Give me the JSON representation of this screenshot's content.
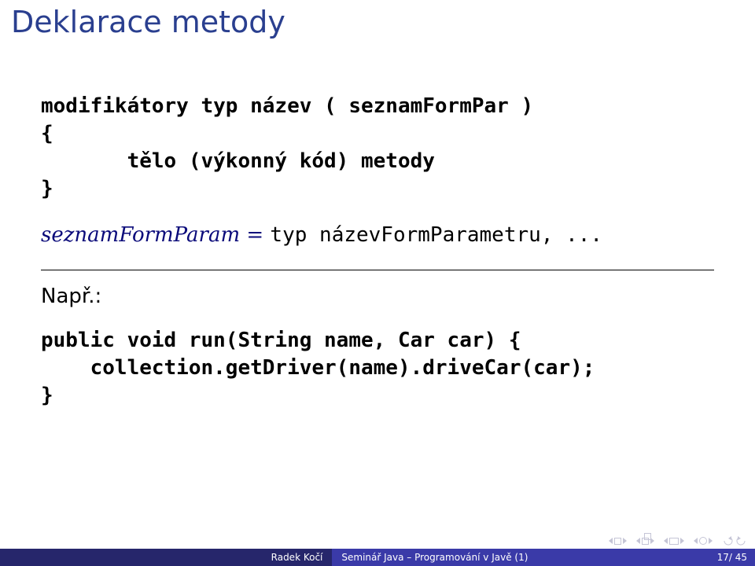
{
  "title": "Deklarace metody",
  "decl": {
    "line1": "modifikátory typ název ( seznamFormPar )",
    "line2": "{",
    "line3_indent": "       ",
    "line3": "tělo (výkonný kód) metody",
    "line4": "}"
  },
  "param_def": {
    "lhs": "seznamFormParam",
    "eq": " = ",
    "rhs": "typ názevFormParametru, ..."
  },
  "example_label": "Např.:",
  "example": {
    "l1": "public void run(String name, Car car) {",
    "l2": "    collection.getDriver(name).driveCar(car);",
    "l3": "}"
  },
  "footer": {
    "author": "Radek Kočí",
    "lecture": "Seminář Java – Programování v Javě (1)",
    "page": "17/ 45"
  }
}
